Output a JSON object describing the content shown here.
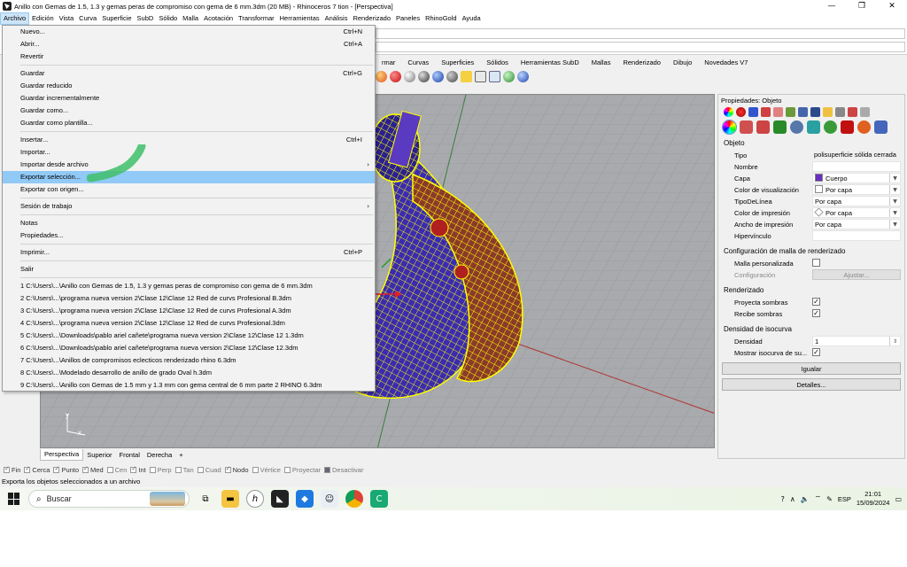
{
  "window": {
    "title": "Anillo con Gemas de 1.5, 1.3 y gemas peras de compromiso con gema de 6 mm.3dm (20 MB) - Rhinoceros 7 tion - [Perspectiva]",
    "controls": {
      "minimize": "—",
      "maximize": "❐",
      "close": "✕"
    }
  },
  "menubar": [
    "Archivo",
    "Edición",
    "Vista",
    "Curva",
    "Superficie",
    "SubD",
    "Sólido",
    "Malla",
    "Acotación",
    "Transformar",
    "Herramientas",
    "Análisis",
    "Renderizado",
    "Paneles",
    "RhinoGold",
    "Ayuda"
  ],
  "menu": {
    "groups": [
      [
        {
          "label": "Nuevo...",
          "shortcut": "Ctrl+N"
        },
        {
          "label": "Abrir...",
          "shortcut": "Ctrl+A"
        },
        {
          "label": "Revertir",
          "shortcut": ""
        }
      ],
      [
        {
          "label": "Guardar",
          "shortcut": "Ctrl+G"
        },
        {
          "label": "Guardar reducido",
          "shortcut": ""
        },
        {
          "label": "Guardar incrementalmente",
          "shortcut": ""
        },
        {
          "label": "Guardar como...",
          "shortcut": ""
        },
        {
          "label": "Guardar como plantilla...",
          "shortcut": ""
        }
      ],
      [
        {
          "label": "Insertar...",
          "shortcut": "Ctrl+I"
        },
        {
          "label": "Importar...",
          "shortcut": ""
        },
        {
          "label": "Importar desde archivo",
          "shortcut": "",
          "submenu": true
        },
        {
          "label": "Exportar selección...",
          "shortcut": "",
          "highlighted": true
        },
        {
          "label": "Exportar con origen...",
          "shortcut": ""
        }
      ],
      [
        {
          "label": "Sesión de trabajo",
          "shortcut": "",
          "submenu": true
        }
      ],
      [
        {
          "label": "Notas",
          "shortcut": ""
        },
        {
          "label": "Propiedades...",
          "shortcut": ""
        }
      ],
      [
        {
          "label": "Imprimir...",
          "shortcut": "Ctrl+P"
        }
      ],
      [
        {
          "label": "Salir",
          "shortcut": ""
        }
      ],
      [
        {
          "label": "1 C:\\Users\\...\\Anillo con Gemas de 1.5, 1.3 y gemas peras de compromiso con gema de 6 mm.3dm",
          "shortcut": ""
        },
        {
          "label": "2 C:\\Users\\...\\programa nueva version 2\\Clase 12\\Clase 12 Red de curvs Profesional B.3dm",
          "shortcut": ""
        },
        {
          "label": "3 C:\\Users\\...\\programa nueva version 2\\Clase 12\\Clase 12 Red de curvs Profesional A.3dm",
          "shortcut": ""
        },
        {
          "label": "4 C:\\Users\\...\\programa nueva version 2\\Clase 12\\Clase 12 Red de curvs Profesional.3dm",
          "shortcut": ""
        },
        {
          "label": "5 C:\\Users\\...\\Downloads\\pablo ariel cañete\\programa nueva version 2\\Clase 12\\Clase 12 1.3dm",
          "shortcut": ""
        },
        {
          "label": "6 C:\\Users\\...\\Downloads\\pablo ariel cañete\\programa nueva version 2\\Clase 12\\Clase 12.3dm",
          "shortcut": ""
        },
        {
          "label": "7 C:\\Users\\...\\Anillos de compromisos eclecticos renderizado rhino 6.3dm",
          "shortcut": ""
        },
        {
          "label": "8 C:\\Users\\...\\Modelado desarrollo de anillo de grado Oval h.3dm",
          "shortcut": ""
        },
        {
          "label": "9 C:\\Users\\...\\Anillo con Gemas de 1.5 mm y 1.3 mm con gema central de 6 mm parte 2 RHINO 6.3dm",
          "shortcut": ""
        }
      ]
    ]
  },
  "toolbar_tabs": [
    "rmar",
    "Curvas",
    "Superficies",
    "Sólidos",
    "Herramientas SubD",
    "Mallas",
    "Renderizado",
    "Dibujo",
    "Novedades V7"
  ],
  "viewport": {
    "name": "Perspectiva",
    "axis_labels": [
      "y",
      "x"
    ]
  },
  "viewport_tabs": [
    "Perspectiva",
    "Superior",
    "Frontal",
    "Derecha",
    "+"
  ],
  "osnaps": [
    {
      "label": "Fin",
      "checked": true
    },
    {
      "label": "Cerca",
      "checked": true
    },
    {
      "label": "Punto",
      "checked": true
    },
    {
      "label": "Med",
      "checked": true
    },
    {
      "label": "Cen",
      "checked": false
    },
    {
      "label": "Int",
      "checked": true
    },
    {
      "label": "Perp",
      "checked": false
    },
    {
      "label": "Tan",
      "checked": false
    },
    {
      "label": "Cuad",
      "checked": false
    },
    {
      "label": "Nodo",
      "checked": true
    },
    {
      "label": "Vértice",
      "checked": false
    },
    {
      "label": "Proyectar",
      "checked": false
    },
    {
      "label": "Desactivar",
      "checked": false,
      "square": true
    }
  ],
  "status": "Exporta los objetos seleccionados a un archivo",
  "properties": {
    "header": "Propiedades: Objeto",
    "section_objeto": "Objeto",
    "tipo_label": "Tipo",
    "tipo_value": "polisuperficie sólida cerrada",
    "nombre_label": "Nombre",
    "nombre_value": "",
    "capa_label": "Capa",
    "capa_value": "Cuerpo",
    "capa_color": "#6a2fc0",
    "colorvis_label": "Color de visualización",
    "colorvis_value": "Por capa",
    "tipolinea_label": "TipoDeLínea",
    "tipolinea_value": "Por capa",
    "colorimp_label": "Color de impresión",
    "colorimp_value": "Por capa",
    "anchoimp_label": "Ancho de impresión",
    "anchoimp_value": "Por capa",
    "hiper_label": "Hipervínculo",
    "hiper_value": "",
    "section_malla": "Configuración de malla de renderizado",
    "malla_label": "Malla personalizada",
    "config_label": "Configuración",
    "ajustar": "Ajustar...",
    "section_render": "Renderizado",
    "proyecta_label": "Proyecta sombras",
    "recibe_label": "Recibe sombras",
    "section_iso": "Densidad de isocurva",
    "densidad_label": "Densidad",
    "densidad_value": "1",
    "mostrar_label": "Mostrar isocurva de su...",
    "igualar": "Igualar",
    "detalles": "Detalles..."
  },
  "taskbar": {
    "search_placeholder": "Buscar",
    "language": "ESP",
    "time": "21:01",
    "date": "15/09/2024"
  },
  "colors": {
    "menu_highlight": "#91c9f7",
    "viewport_bg": "#a8aaad",
    "wire": "#ffff00",
    "metal": "#3a2bb0"
  }
}
